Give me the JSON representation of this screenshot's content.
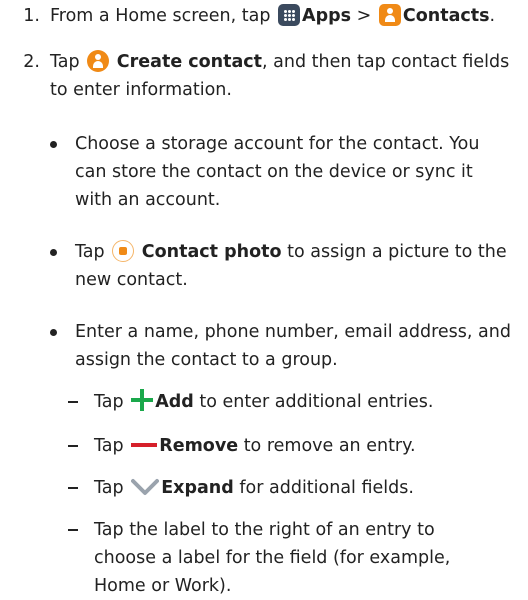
{
  "steps": [
    {
      "number": "1.",
      "pre": "From a Home screen, tap",
      "apps": "Apps",
      "sep": ">",
      "contacts": "Contacts",
      "end": "."
    },
    {
      "number": "2.",
      "pre": "Tap",
      "create": "Create contact",
      "rest1": ", and then tap contact fields",
      "rest2": "to enter information."
    }
  ],
  "bullets": [
    {
      "lines": [
        "Choose a storage account for the contact. You",
        "can store the contact on the device or sync it",
        "with an account."
      ]
    },
    {
      "pre": "Tap",
      "bold": "Contact photo",
      "rest1": "to assign a picture to the",
      "rest2": "new contact."
    },
    {
      "lines": [
        "Enter a name, phone number, email address, and",
        "assign the contact to a group."
      ]
    }
  ],
  "subitems": [
    {
      "pre": "Tap",
      "bold": "Add",
      "rest": "to enter additional entries.",
      "icon": "plus-icon",
      "color": "#1aa84b"
    },
    {
      "pre": "Tap",
      "bold": "Remove",
      "rest": "to remove an entry.",
      "icon": "minus-icon",
      "color": "#d6202a"
    },
    {
      "pre": "Tap",
      "bold": "Expand",
      "rest": "for additional fields.",
      "icon": "chevron-down-icon",
      "color": "#9aa3ad"
    },
    {
      "lines": [
        "Tap the label to the right of an entry to",
        "choose a label for the field (for example,",
        "Home or Work)."
      ]
    }
  ],
  "colors": {
    "text": "#222222",
    "apps_icon": "#3b4a5e",
    "contacts_icon": "#f08a16"
  }
}
